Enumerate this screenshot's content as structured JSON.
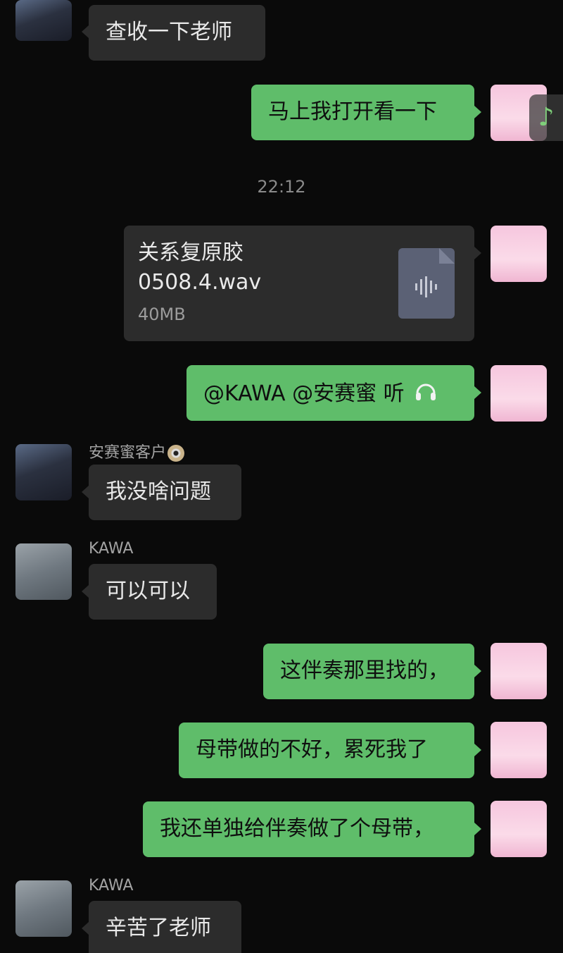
{
  "messages": {
    "m1": {
      "text": "查收一下老师"
    },
    "m2": {
      "text": "马上我打开看一下"
    },
    "time1": "22:12",
    "file": {
      "name_line1": "关系复原胶",
      "name_line2": "0508.4.wav",
      "size": "40MB",
      "icon": "audio-file-icon"
    },
    "m3": {
      "text": "@KAWA @安赛蜜 听",
      "emoji": "headphones-icon"
    },
    "m4": {
      "sender": "安赛蜜客户",
      "sender_emoji": "cd-icon",
      "text": "我没啥问题"
    },
    "m5": {
      "sender": "KAWA",
      "text": "可以可以"
    },
    "m6": {
      "text": "这伴奏那里找的，"
    },
    "m7": {
      "text": "母带做的不好，累死我了"
    },
    "m8": {
      "text": "我还单独给伴奏做了个母带，"
    },
    "m9": {
      "sender": "KAWA",
      "text": "辛苦了老师"
    }
  },
  "floating": {
    "music_icon": "♪"
  },
  "colors": {
    "background": "#0a0a0a",
    "incoming_bubble": "#2c2c2c",
    "outgoing_bubble": "#5fbd6a"
  }
}
